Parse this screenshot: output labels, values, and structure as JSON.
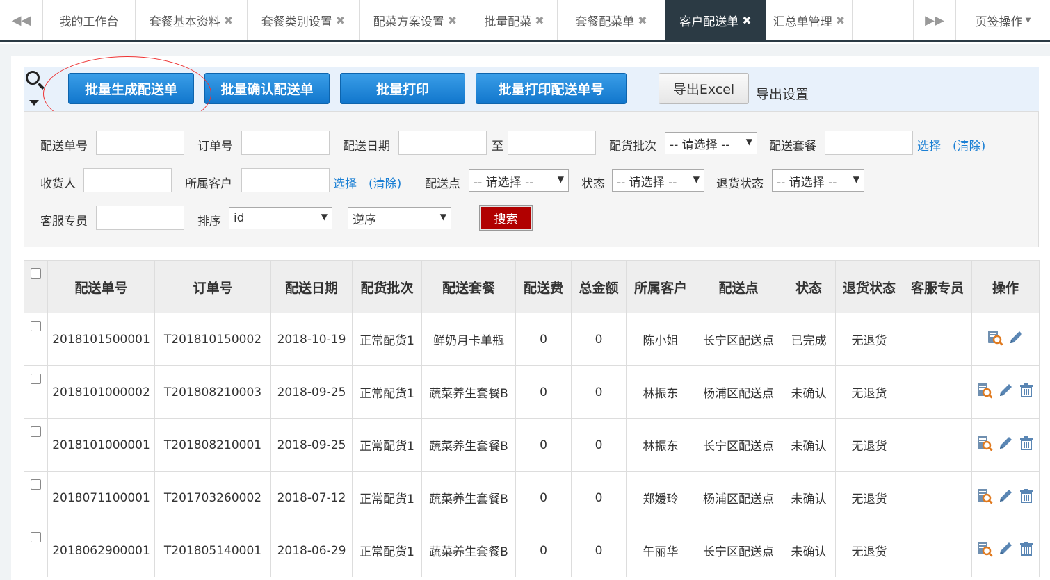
{
  "tabs": {
    "items": [
      {
        "label": "我的工作台",
        "closable": false,
        "active": false
      },
      {
        "label": "套餐基本资料",
        "closable": true,
        "active": false
      },
      {
        "label": "套餐类别设置",
        "closable": true,
        "active": false
      },
      {
        "label": "配菜方案设置",
        "closable": true,
        "active": false
      },
      {
        "label": "批量配菜",
        "closable": true,
        "active": false
      },
      {
        "label": "套餐配菜单",
        "closable": true,
        "active": false
      },
      {
        "label": "客户配送单",
        "closable": true,
        "active": true
      },
      {
        "label": "汇总单管理",
        "closable": true,
        "active": false
      }
    ],
    "ops_label": "页签操作"
  },
  "toolbar": {
    "batch_generate": "批量生成配送单",
    "batch_confirm": "批量确认配送单",
    "batch_print": "批量打印",
    "batch_print_no": "批量打印配送单号",
    "export_excel": "导出Excel",
    "export_settings": "导出设置"
  },
  "filters": {
    "delivery_no": "配送单号",
    "order_no": "订单号",
    "delivery_date": "配送日期",
    "to": "至",
    "batch": "配货批次",
    "batch_value": "-- 请选择 --",
    "package": "配送套餐",
    "select": "选择",
    "clear": "清除",
    "receiver": "收货人",
    "customer": "所属客户",
    "point": "配送点",
    "point_value": "-- 请选择 --",
    "status": "状态",
    "status_value": "-- 请选择 --",
    "return_status": "退货状态",
    "return_value": "-- 请选择 --",
    "service": "客服专员",
    "sort": "排序",
    "sort_value": "id",
    "order_value": "逆序",
    "search": "搜索"
  },
  "table": {
    "headers": [
      "配送单号",
      "订单号",
      "配送日期",
      "配货批次",
      "配送套餐",
      "配送费",
      "总金额",
      "所属客户",
      "配送点",
      "状态",
      "退货状态",
      "客服专员",
      "操作"
    ],
    "rows": [
      [
        "2018101500001",
        "T201810150002",
        "2018-10-19",
        "正常配货1",
        "鲜奶月卡单瓶",
        "0",
        "0",
        "陈小姐",
        "长宁区配送点",
        "已完成",
        "无退货",
        ""
      ],
      [
        "2018101000002",
        "T201808210003",
        "2018-09-25",
        "正常配货1",
        "蔬菜养生套餐B",
        "0",
        "0",
        "林振东",
        "杨浦区配送点",
        "未确认",
        "无退货",
        ""
      ],
      [
        "2018101000001",
        "T201808210001",
        "2018-09-25",
        "正常配货1",
        "蔬菜养生套餐B",
        "0",
        "0",
        "林振东",
        "长宁区配送点",
        "未确认",
        "无退货",
        ""
      ],
      [
        "2018071100001",
        "T201703260002",
        "2018-07-12",
        "正常配货1",
        "蔬菜养生套餐B",
        "0",
        "0",
        "郑媛玲",
        "杨浦区配送点",
        "未确认",
        "无退货",
        ""
      ],
      [
        "2018062900001",
        "T201805140001",
        "2018-06-29",
        "正常配货1",
        "蔬菜养生套餐B",
        "0",
        "0",
        "午丽华",
        "长宁区配送点",
        "未确认",
        "无退货",
        ""
      ]
    ],
    "row_actions": [
      [
        "view-icon",
        "edit-icon"
      ],
      [
        "view-icon",
        "edit-icon",
        "delete-icon"
      ],
      [
        "view-icon",
        "edit-icon",
        "delete-icon"
      ],
      [
        "view-icon",
        "edit-icon",
        "delete-icon"
      ],
      [
        "view-icon",
        "edit-icon",
        "delete-icon"
      ]
    ]
  },
  "colors": {
    "accent": "#1a7fd4",
    "active_tab": "#2b3a44",
    "search_button": "#b10000",
    "highlight_ellipse": "#ee3333"
  }
}
